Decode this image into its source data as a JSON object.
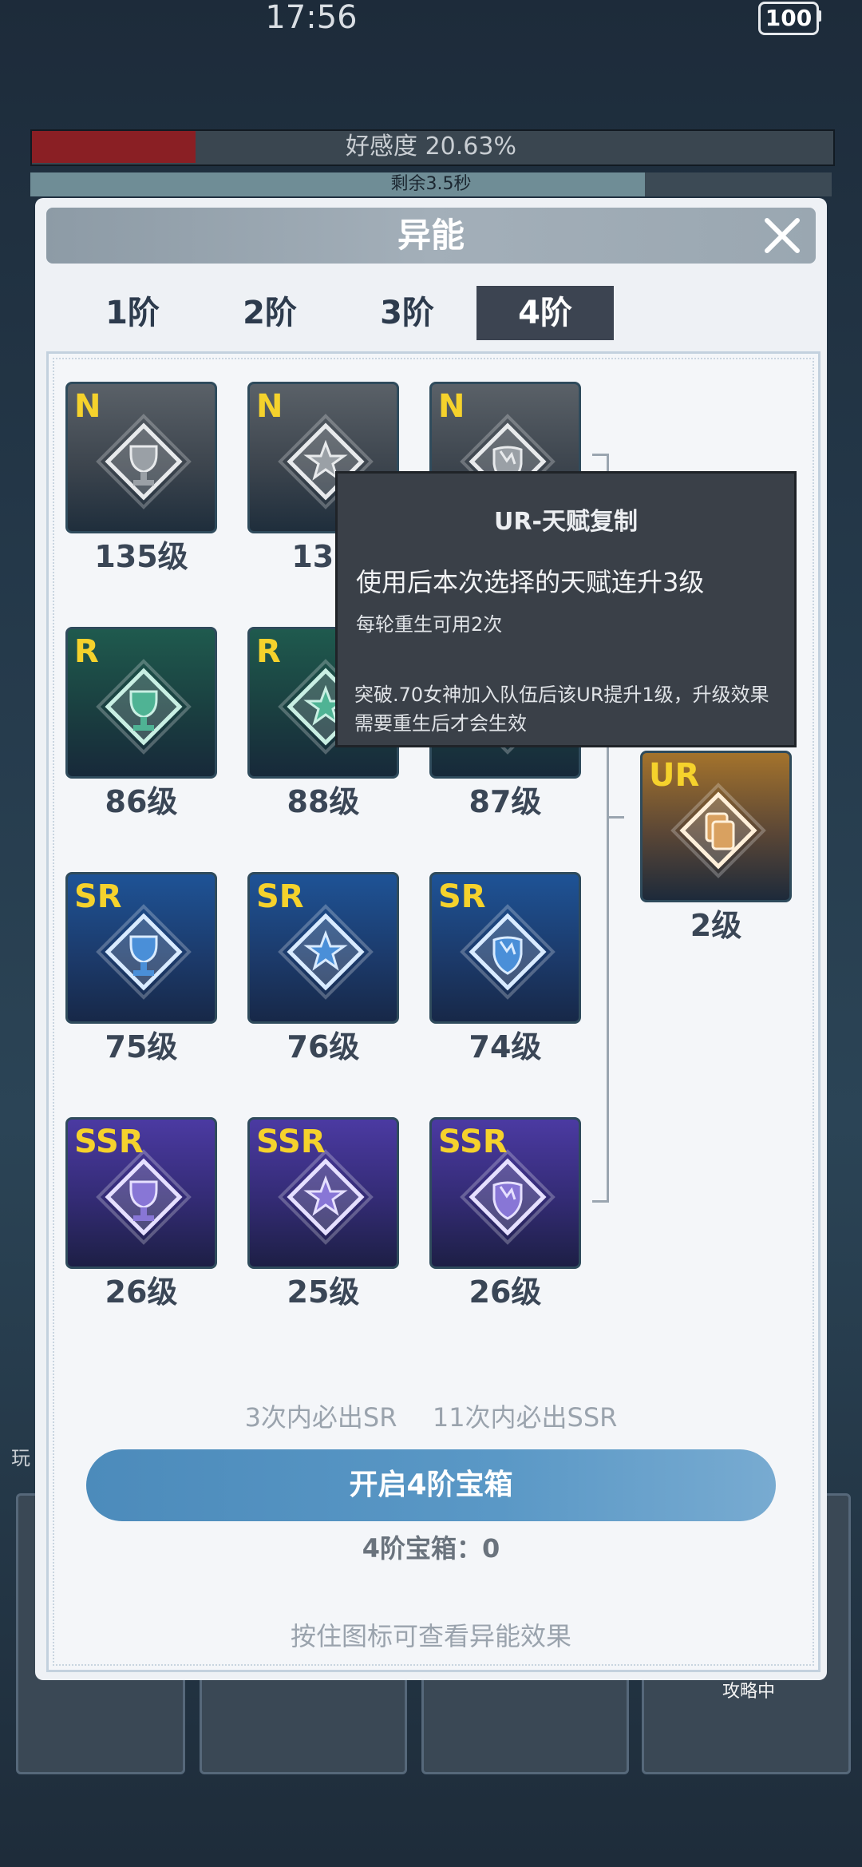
{
  "status_bar": {
    "time": "17:56",
    "battery": "100"
  },
  "background": {
    "affection": "好感度 20.63%",
    "remaining": "剩余3.5秒",
    "strategy": "攻略中",
    "side_text": "玩"
  },
  "modal": {
    "title": "异能"
  },
  "tabs": [
    {
      "label": "1阶",
      "active": false
    },
    {
      "label": "2阶",
      "active": false
    },
    {
      "label": "3阶",
      "active": false
    },
    {
      "label": "4阶",
      "active": true
    }
  ],
  "talents": [
    {
      "rarity": "N",
      "icon": "trophy-icon",
      "level": "135级"
    },
    {
      "rarity": "N",
      "icon": "star-icon",
      "level": "133"
    },
    {
      "rarity": "N",
      "icon": "shield-icon",
      "level": ""
    },
    {
      "rarity": "R",
      "icon": "trophy-icon",
      "level": "86级"
    },
    {
      "rarity": "R",
      "icon": "star-icon",
      "level": "88级"
    },
    {
      "rarity": "R",
      "icon": "shield-icon",
      "level": "87级"
    },
    {
      "rarity": "SR",
      "icon": "trophy-icon",
      "level": "75级"
    },
    {
      "rarity": "SR",
      "icon": "star-icon",
      "level": "76级"
    },
    {
      "rarity": "SR",
      "icon": "shield-icon",
      "level": "74级"
    },
    {
      "rarity": "SSR",
      "icon": "trophy-icon",
      "level": "26级"
    },
    {
      "rarity": "SSR",
      "icon": "star-icon",
      "level": "25级"
    },
    {
      "rarity": "SSR",
      "icon": "shield-icon",
      "level": "26级"
    }
  ],
  "ur_talent": {
    "rarity": "UR",
    "icon": "copy-icon",
    "level": "2级"
  },
  "tooltip": {
    "title": "UR-天赋复制",
    "description": "使用后本次选择的天赋连升3级",
    "usage": "每轮重生可用2次",
    "note": "突破.70女神加入队伍后该UR提升1级，升级效果需要重生后才会生效"
  },
  "guarantee": {
    "sr": "3次内必出SR",
    "ssr": "11次内必出SSR"
  },
  "open_button": "开启4阶宝箱",
  "chest_count": "4阶宝箱：0",
  "hint": "按住图标可查看异能效果",
  "colors": {
    "N": "#4b535b",
    "R": "#1f5a4e",
    "SR": "#1e5396",
    "SSR": "#4b3aa2",
    "UR": "#a4732c",
    "rarity_text": "#f5d22c",
    "button": "#5a98c6"
  }
}
